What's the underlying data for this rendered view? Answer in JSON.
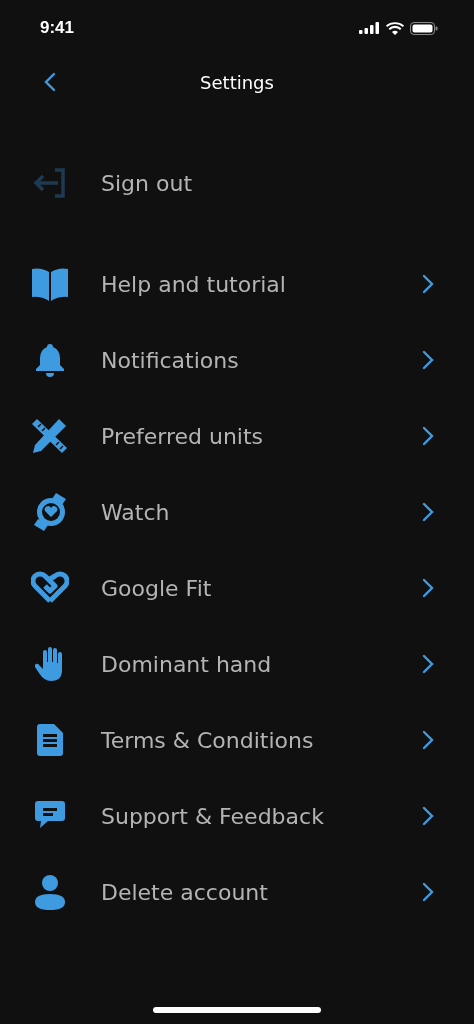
{
  "status_bar": {
    "time": "9:41"
  },
  "nav": {
    "title": "Settings"
  },
  "items": [
    {
      "label": "Sign out",
      "kind": "action"
    },
    {
      "label": "Help and tutorial",
      "kind": "link"
    },
    {
      "label": "Notifications",
      "kind": "link"
    },
    {
      "label": "Preferred units",
      "kind": "link"
    },
    {
      "label": "Watch",
      "kind": "link"
    },
    {
      "label": "Google Fit",
      "kind": "link"
    },
    {
      "label": "Dominant hand",
      "kind": "link"
    },
    {
      "label": "Terms & Conditions",
      "kind": "link"
    },
    {
      "label": "Support & Feedback",
      "kind": "link"
    },
    {
      "label": "Delete account",
      "kind": "link"
    }
  ]
}
